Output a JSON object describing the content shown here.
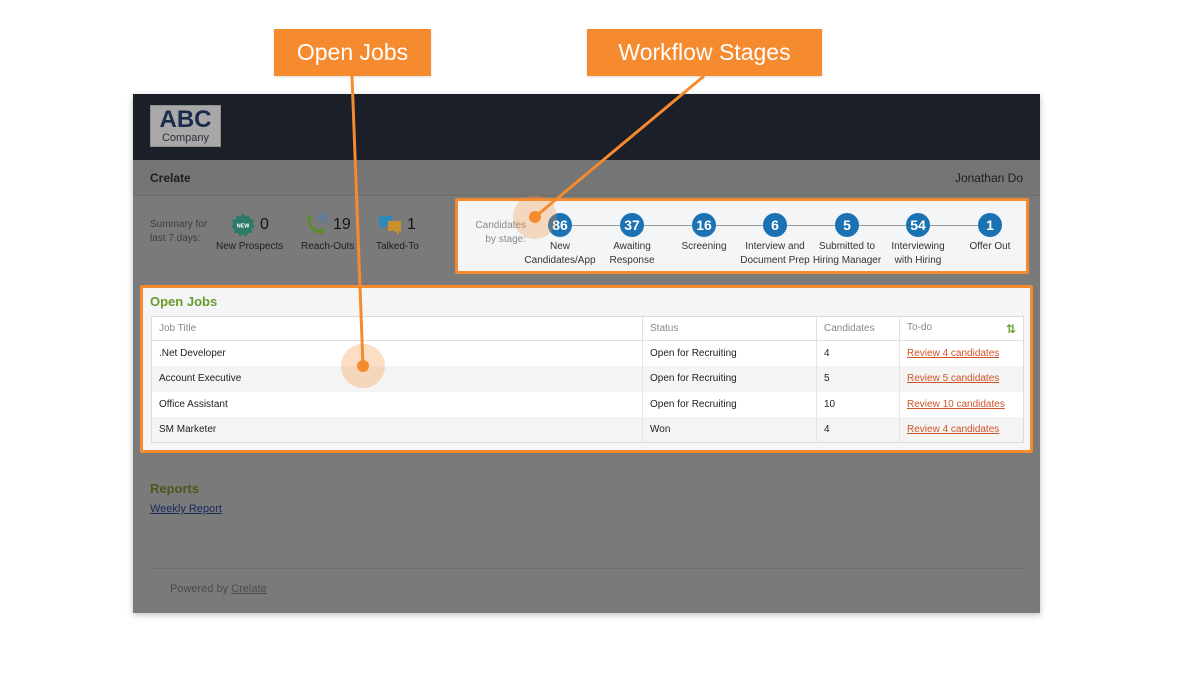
{
  "callouts": {
    "open_jobs": "Open Jobs",
    "workflow_stages": "Workflow Stages"
  },
  "header": {
    "logo_main": "ABC",
    "logo_sub": "Company",
    "brand": "Crelate",
    "user_name": "Jonathan Do"
  },
  "summary": {
    "label_line1": "Summary for",
    "label_line2": "last 7 days:",
    "stats": [
      {
        "icon": "new-badge-icon",
        "value": "0",
        "label": "New Prospects"
      },
      {
        "icon": "phone-icon",
        "value": "19",
        "label": "Reach-Outs"
      },
      {
        "icon": "chat-bubbles-icon",
        "value": "1",
        "label": "Talked-To"
      }
    ]
  },
  "stages": {
    "label_line1": "Candidates",
    "label_line2": "by stage:",
    "items": [
      {
        "count": "86",
        "name_line1": "New",
        "name_line2": "Candidates/App"
      },
      {
        "count": "37",
        "name_line1": "Awaiting",
        "name_line2": "Response"
      },
      {
        "count": "16",
        "name_line1": "Screening",
        "name_line2": ""
      },
      {
        "count": "6",
        "name_line1": "Interview and",
        "name_line2": "Document Prep"
      },
      {
        "count": "5",
        "name_line1": "Submitted to",
        "name_line2": "Hiring Manager"
      },
      {
        "count": "54",
        "name_line1": "Interviewing",
        "name_line2": "with Hiring"
      },
      {
        "count": "1",
        "name_line1": "Offer Out",
        "name_line2": ""
      }
    ]
  },
  "open_jobs": {
    "title": "Open Jobs",
    "columns": [
      "Job Title",
      "Status",
      "Candidates",
      "To-do"
    ],
    "refresh_icon": "refresh-icon",
    "rows": [
      {
        "title": ".Net Developer",
        "status": "Open for Recruiting",
        "candidates": "4",
        "todo": "Review 4 candidates"
      },
      {
        "title": "Account Executive",
        "status": "Open for Recruiting",
        "candidates": "5",
        "todo": "Review 5 candidates"
      },
      {
        "title": "Office Assistant",
        "status": "Open for Recruiting",
        "candidates": "10",
        "todo": "Review 10 candidates"
      },
      {
        "title": "SM Marketer",
        "status": "Won",
        "candidates": "4",
        "todo": "Review 4 candidates"
      }
    ]
  },
  "reports": {
    "title": "Reports",
    "link": "Weekly Report"
  },
  "footer": {
    "prefix": "Powered by",
    "link": "Crelate"
  },
  "colors": {
    "accent_orange": "#f58a2f",
    "stage_blue": "#1b72b3",
    "section_green": "#6a9a2a",
    "link_red": "#d0532a"
  }
}
